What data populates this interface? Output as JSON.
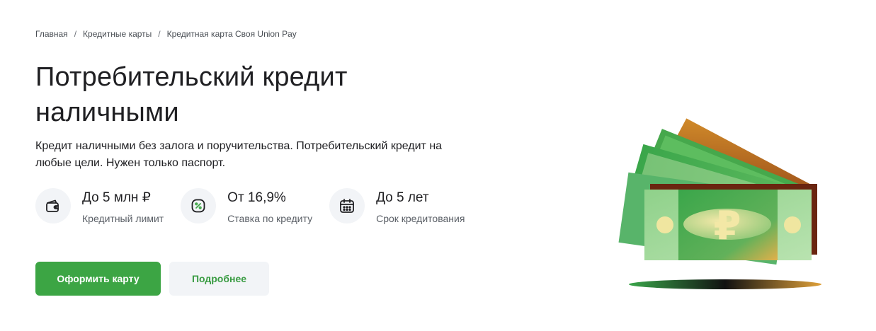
{
  "breadcrumb": {
    "items": [
      "Главная",
      "Кредитные карты"
    ],
    "current": "Кредитная карта Своя Union Pay",
    "separator": "/"
  },
  "hero": {
    "title": "Потребительский кредит наличными",
    "description": "Кредит наличными без залога и поручительства. Потребительский кредит на любые цели. Нужен только паспорт."
  },
  "features": [
    {
      "icon": "wallet-icon",
      "value": "До 5 млн ₽",
      "label": "Кредитный лимит"
    },
    {
      "icon": "percent-icon",
      "value": "От 16,9%",
      "label": "Ставка по кредиту"
    },
    {
      "icon": "calendar-icon",
      "value": "До 5 лет",
      "label": "Срок кредитования"
    }
  ],
  "buttons": {
    "primary": "Оформить карту",
    "secondary": "Подробнее"
  },
  "illustration": {
    "icon": "money-banknotes-illustration",
    "symbol": "₽"
  },
  "colors": {
    "accent": "#3ca544",
    "icon_bg": "#f2f4f7",
    "text": "#1f1f22",
    "muted": "#5a5f66"
  }
}
